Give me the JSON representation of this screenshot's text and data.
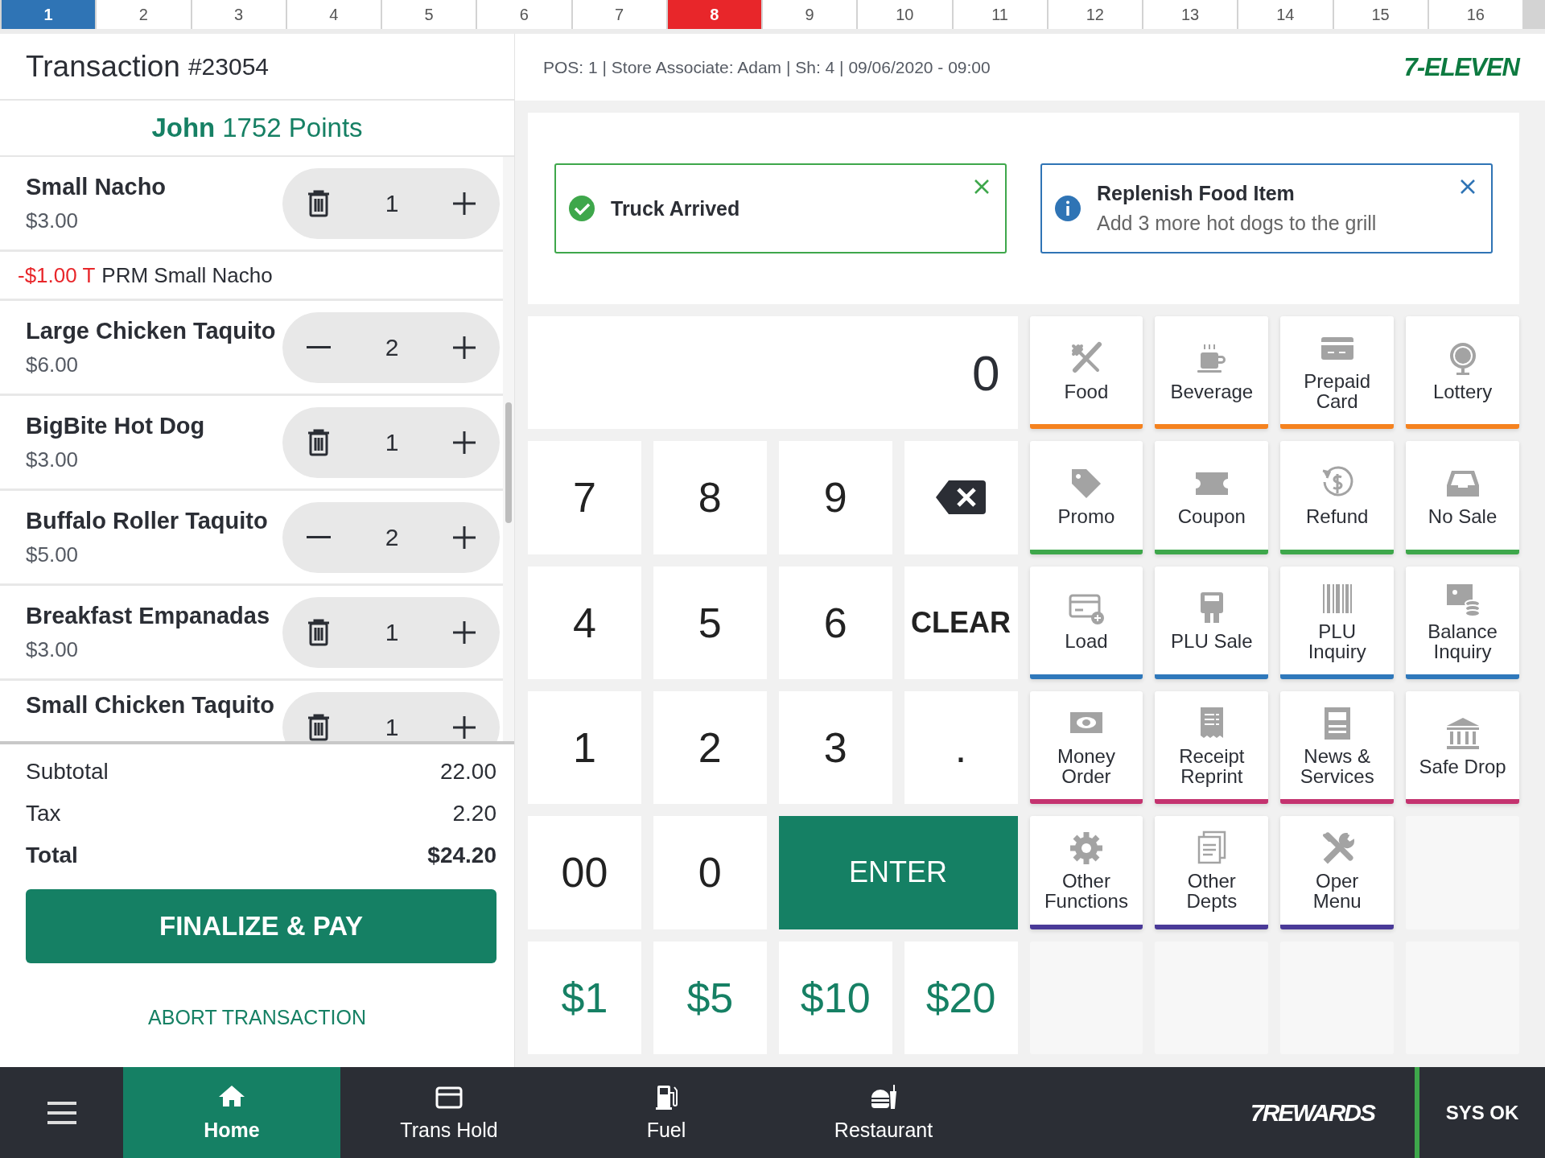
{
  "top_tabs": [
    {
      "label": "1",
      "selected": true,
      "alert": false
    },
    {
      "label": "2",
      "selected": false,
      "alert": false
    },
    {
      "label": "3",
      "selected": false,
      "alert": false
    },
    {
      "label": "4",
      "selected": false,
      "alert": false
    },
    {
      "label": "5",
      "selected": false,
      "alert": false
    },
    {
      "label": "6",
      "selected": false,
      "alert": false
    },
    {
      "label": "7",
      "selected": false,
      "alert": false
    },
    {
      "label": "8",
      "selected": false,
      "alert": true
    },
    {
      "label": "9",
      "selected": false,
      "alert": false
    },
    {
      "label": "10",
      "selected": false,
      "alert": false
    },
    {
      "label": "11",
      "selected": false,
      "alert": false
    },
    {
      "label": "12",
      "selected": false,
      "alert": false
    },
    {
      "label": "13",
      "selected": false,
      "alert": false
    },
    {
      "label": "14",
      "selected": false,
      "alert": false
    },
    {
      "label": "15",
      "selected": false,
      "alert": false
    },
    {
      "label": "16",
      "selected": false,
      "alert": false
    }
  ],
  "transaction": {
    "title": "Transaction",
    "number": "#23054"
  },
  "customer": {
    "name": "John",
    "points": "1752 Points"
  },
  "lines": [
    {
      "kind": "item",
      "name": "Small Nacho",
      "price": "$3.00",
      "quantity": "1",
      "removable": true
    },
    {
      "kind": "discount",
      "amount": "-$1.00 T",
      "description": "PRM Small Nacho"
    },
    {
      "kind": "item",
      "name": "Large Chicken Taquito",
      "price": "$6.00",
      "quantity": "2",
      "removable": false
    },
    {
      "kind": "item",
      "name": "BigBite Hot Dog",
      "price": "$3.00",
      "quantity": "1",
      "removable": true
    },
    {
      "kind": "item",
      "name": "Buffalo Roller Taquito",
      "price": "$5.00",
      "quantity": "2",
      "removable": false
    },
    {
      "kind": "item",
      "name": "Breakfast Empanadas",
      "price": "$3.00",
      "quantity": "1",
      "removable": true
    },
    {
      "kind": "item",
      "name": "Small Chicken Taquito",
      "quantity": "1",
      "removable": true
    }
  ],
  "totals": [
    {
      "label": "Subtotal",
      "value": "22.00",
      "bold": false
    },
    {
      "label": "Tax",
      "value": "2.20",
      "bold": false
    },
    {
      "label": "Total",
      "value": "$24.20",
      "bold": true
    }
  ],
  "finalize_button": "FINALIZE & PAY",
  "abort_link": "ABORT TRANSACTION",
  "info_bar": {
    "text": "POS: 1 | Store Associate: Adam | Sh: 4 | 09/06/2020 - 09:00",
    "logo": "7-ELEVEN"
  },
  "notifications": [
    {
      "kind": "success",
      "title": "Truck Arrived"
    },
    {
      "kind": "info",
      "title": "Replenish Food Item",
      "message": "Add 3 more hot dogs to the grill"
    }
  ],
  "keypad": {
    "display": "0",
    "keys": [
      {
        "kind": "digit",
        "label": "7"
      },
      {
        "kind": "digit",
        "label": "8"
      },
      {
        "kind": "digit",
        "label": "9"
      },
      {
        "kind": "backspace"
      },
      {
        "kind": "digit",
        "label": "4"
      },
      {
        "kind": "digit",
        "label": "5"
      },
      {
        "kind": "digit",
        "label": "6"
      },
      {
        "kind": "clear",
        "label": "CLEAR"
      },
      {
        "kind": "digit",
        "label": "1"
      },
      {
        "kind": "digit",
        "label": "2"
      },
      {
        "kind": "digit",
        "label": "3"
      },
      {
        "kind": "digit",
        "label": "."
      },
      {
        "kind": "digit",
        "label": "00"
      },
      {
        "kind": "digit",
        "label": "0"
      },
      {
        "kind": "enter",
        "label": "ENTER"
      },
      {
        "kind": "cash",
        "label": "$1"
      },
      {
        "kind": "cash",
        "label": "$5"
      },
      {
        "kind": "cash",
        "label": "$10"
      },
      {
        "kind": "cash",
        "label": "$20"
      }
    ]
  },
  "functions": [
    {
      "label": "Food",
      "color": "#f5821f"
    },
    {
      "label": "Beverage",
      "color": "#f5821f"
    },
    {
      "label": "Prepaid Card",
      "color": "#f5821f"
    },
    {
      "label": "Lottery",
      "color": "#f5821f"
    },
    {
      "label": "Promo",
      "color": "#3ea74b"
    },
    {
      "label": "Coupon",
      "color": "#3ea74b"
    },
    {
      "label": "Refund",
      "color": "#3ea74b"
    },
    {
      "label": "No Sale",
      "color": "#3ea74b"
    },
    {
      "label": "Load",
      "color": "#2f78bb"
    },
    {
      "label": "PLU Sale",
      "color": "#2f78bb"
    },
    {
      "label": "PLU Inquiry",
      "color": "#2f78bb"
    },
    {
      "label": "Balance Inquiry",
      "color": "#2f78bb"
    },
    {
      "label": "Money Order",
      "color": "#c4336f"
    },
    {
      "label": "Receipt Reprint",
      "color": "#c4336f"
    },
    {
      "label": "News & Services",
      "color": "#c4336f"
    },
    {
      "label": "Safe Drop",
      "color": "#c4336f"
    },
    {
      "label": "Other Functions",
      "color": "#4a3a98"
    },
    {
      "label": "Other Depts",
      "color": "#4a3a98"
    },
    {
      "label": "Oper Menu",
      "color": "#4a3a98"
    }
  ],
  "nav": [
    {
      "label": "Home",
      "selected": true
    },
    {
      "label": "Trans Hold",
      "selected": false
    },
    {
      "label": "Fuel",
      "selected": false
    },
    {
      "label": "Restaurant",
      "selected": false
    }
  ],
  "rewards_logo": "7REWARDS",
  "status": "SYS OK"
}
